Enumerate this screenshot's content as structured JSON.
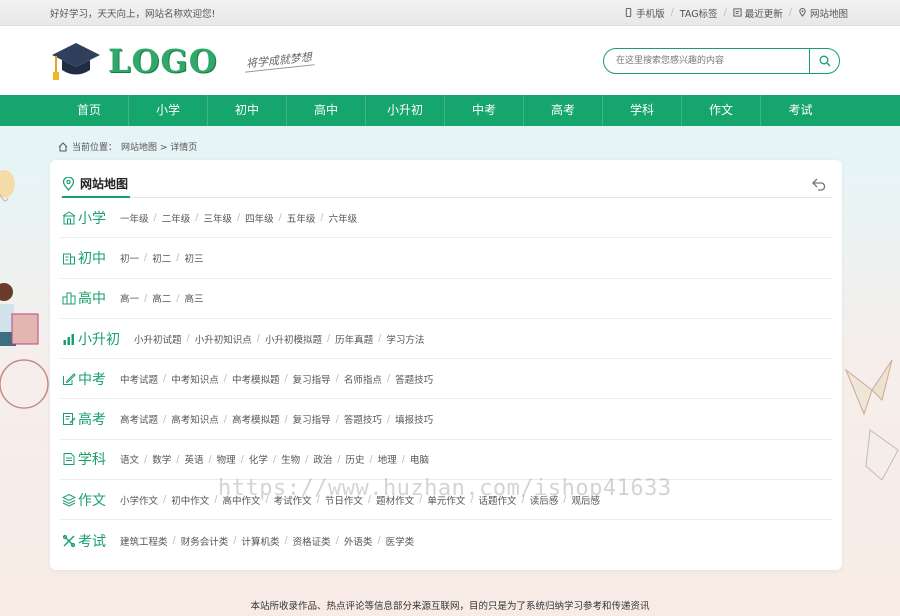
{
  "topbar": {
    "welcome": "好好学习，天天向上，网站名称欢迎您!",
    "links": [
      "手机版",
      "TAG标签",
      "最近更新",
      "网站地图"
    ]
  },
  "header": {
    "logo_text": "LOGO",
    "slogan": "将学成就梦想",
    "search_placeholder": "在这里搜索您感兴趣的内容"
  },
  "nav": [
    "首页",
    "小学",
    "初中",
    "高中",
    "小升初",
    "中考",
    "高考",
    "学科",
    "作文",
    "考试"
  ],
  "breadcrumb": {
    "prefix": "当前位置：",
    "trail": "网站地图 > 详情页"
  },
  "sitemap": {
    "title": "网站地图",
    "categories": [
      {
        "name": "小学",
        "icon": "school-icon",
        "items": [
          "一年级",
          "二年级",
          "三年级",
          "四年级",
          "五年级",
          "六年级"
        ]
      },
      {
        "name": "初中",
        "icon": "building-icon",
        "items": [
          "初一",
          "初二",
          "初三"
        ]
      },
      {
        "name": "高中",
        "icon": "city-icon",
        "items": [
          "高一",
          "高二",
          "高三"
        ]
      },
      {
        "name": "小升初",
        "icon": "bar-chart-icon",
        "items": [
          "小升初试题",
          "小升初知识点",
          "小升初模拟题",
          "历年真题",
          "学习方法"
        ]
      },
      {
        "name": "中考",
        "icon": "pencil-square-icon",
        "items": [
          "中考试题",
          "中考知识点",
          "中考模拟题",
          "复习指导",
          "名师指点",
          "答题技巧"
        ]
      },
      {
        "name": "高考",
        "icon": "edit-note-icon",
        "items": [
          "高考试题",
          "高考知识点",
          "高考模拟题",
          "复习指导",
          "答题技巧",
          "填报技巧"
        ]
      },
      {
        "name": "学科",
        "icon": "document-icon",
        "items": [
          "语文",
          "数学",
          "英语",
          "物理",
          "化学",
          "生物",
          "政治",
          "历史",
          "地理",
          "电脑"
        ]
      },
      {
        "name": "作文",
        "icon": "layers-icon",
        "items": [
          "小学作文",
          "初中作文",
          "高中作文",
          "考试作文",
          "节日作文",
          "题材作文",
          "单元作文",
          "话题作文",
          "读后感",
          "观后感"
        ]
      },
      {
        "name": "考试",
        "icon": "tools-icon",
        "items": [
          "建筑工程类",
          "财务会计类",
          "计算机类",
          "资格证类",
          "外语类",
          "医学类"
        ]
      }
    ]
  },
  "footer": {
    "notice": "本站所收录作品、热点评论等信息部分来源互联网，目的只是为了系统归纳学习参考和传递资讯"
  },
  "watermark": "https://www.huzhan.com/ishop41633",
  "colors": {
    "brand_green": "#15a56d",
    "link_text": "#555555"
  }
}
